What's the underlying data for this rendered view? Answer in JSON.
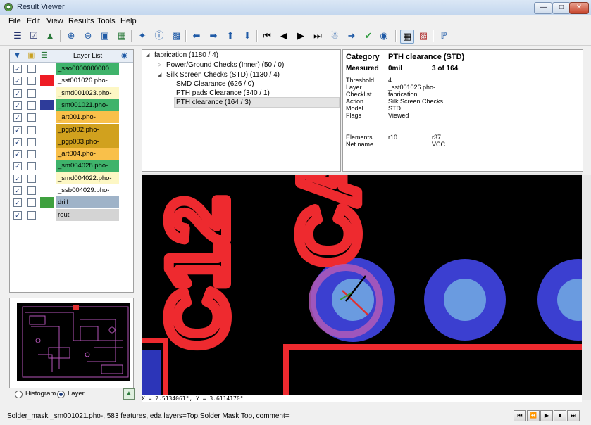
{
  "window": {
    "title": "Result Viewer",
    "minimize_icon": "minimize-icon",
    "maximize_icon": "maximize-icon",
    "close_icon": "close-icon"
  },
  "menu": {
    "items": [
      "File",
      "Edit",
      "View",
      "Results",
      "Tools",
      "Help"
    ]
  },
  "layers": {
    "header": "Layer List",
    "rows": [
      {
        "name": "_sso0000000000",
        "visible": true,
        "locked": false,
        "color": "",
        "bg": "#3fb36b"
      },
      {
        "name": "_sst001026.pho-",
        "visible": true,
        "locked": false,
        "color": "#ee1c24",
        "bg": "#ffffff"
      },
      {
        "name": "_smd001023.pho-",
        "visible": true,
        "locked": false,
        "color": "",
        "bg": "#fdf7c4"
      },
      {
        "name": "_sm001021.pho-",
        "visible": true,
        "locked": false,
        "color": "#2e3c9a",
        "bg": "#3fb36b"
      },
      {
        "name": "_art001.pho-",
        "visible": true,
        "locked": false,
        "color": "",
        "bg": "#f9c04a"
      },
      {
        "name": "_pgp002.pho-",
        "visible": true,
        "locked": false,
        "color": "",
        "bg": "#d1a11e"
      },
      {
        "name": "_pgp003.pho-",
        "visible": true,
        "locked": false,
        "color": "",
        "bg": "#d1a11e"
      },
      {
        "name": "_art004.pho-",
        "visible": true,
        "locked": false,
        "color": "",
        "bg": "#f9c04a"
      },
      {
        "name": "_sm004028.pho-",
        "visible": true,
        "locked": false,
        "color": "",
        "bg": "#3fb36b"
      },
      {
        "name": "_smd004022.pho-",
        "visible": true,
        "locked": false,
        "color": "",
        "bg": "#fdf7c4"
      },
      {
        "name": "_ssb004029.pho-",
        "visible": true,
        "locked": false,
        "color": "",
        "bg": "#ffffff"
      },
      {
        "name": "drill",
        "visible": true,
        "locked": false,
        "color": "#3fa13f",
        "bg": "#9fb3c8"
      },
      {
        "name": "rout",
        "visible": true,
        "locked": false,
        "color": "",
        "bg": "#d4d4d4"
      }
    ]
  },
  "view_mode": {
    "options": [
      "Histogram",
      "Layer"
    ],
    "selected": "Layer"
  },
  "tree": {
    "root": "fabrication (1180 / 4)",
    "children": [
      {
        "label": "Power/Ground Checks (Inner) (50 / 0)",
        "expanded": false
      },
      {
        "label": "Silk Screen Checks (STD) (1130 / 4)",
        "expanded": true,
        "children": [
          "SMD Clearance (626 / 0)",
          "PTH pads Clearance (340 / 1)",
          "PTH clearance (164 / 3)"
        ]
      }
    ],
    "selected": "PTH clearance (164 / 3)"
  },
  "details": {
    "category_label": "Category",
    "category_value": "PTH clearance  (STD)",
    "measured_label": "Measured",
    "measured_value": "0mil",
    "position": "3 of 164",
    "fields": [
      {
        "label": "Threshold",
        "value": "4"
      },
      {
        "label": "Layer",
        "value": "_sst001026.pho-"
      },
      {
        "label": "Checklist",
        "value": "fabrication"
      },
      {
        "label": "Action",
        "value": "Silk Screen Checks"
      },
      {
        "label": "Model",
        "value": "STD"
      },
      {
        "label": "Flags",
        "value": "Viewed"
      }
    ],
    "elements_label": "Elements",
    "elements_a": "r10",
    "elements_b": "r37",
    "netname_label": "Net name",
    "netname_value": "VCC"
  },
  "canvas": {
    "silk_text_1": "C12",
    "silk_text_2": "CAP",
    "coords": "X = 2.5134061\", Y = 3.6114170\""
  },
  "status": {
    "text": "Solder_mask _sm001021.pho-, 583 features, eda layers=Top,Solder Mask Top, comment="
  },
  "colors": {
    "silk": "#ee2a2f",
    "pad_outer": "#3b3fd0",
    "pad_inner": "#6a9be0",
    "highlight": "#b25ab8"
  }
}
